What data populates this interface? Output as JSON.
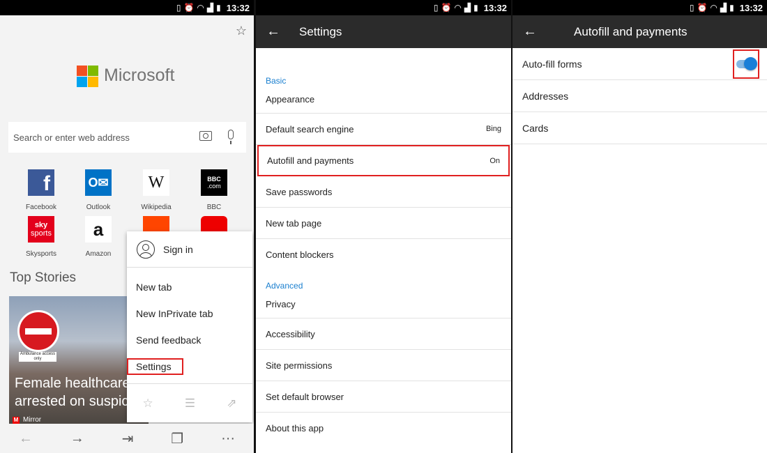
{
  "status": {
    "time": "13:32",
    "icons": [
      "vibrate-icon",
      "alarm-icon",
      "wifi-icon",
      "signal-icon",
      "battery-icon"
    ]
  },
  "home": {
    "brand": "Microsoft",
    "search_placeholder": "Search or enter web address",
    "tiles": [
      {
        "label": "Facebook",
        "glyph": "f",
        "color": "#3b5998"
      },
      {
        "label": "Outlook",
        "glyph": "O",
        "color": "#0072c6"
      },
      {
        "label": "Wikipedia",
        "glyph": "W",
        "color": "#ffffff"
      },
      {
        "label": "BBC",
        "glyph": "BBC",
        "color": "#000000"
      },
      {
        "label": "Skysports",
        "glyph": "sky",
        "color": "#e3001b"
      },
      {
        "label": "Amazon",
        "glyph": "a",
        "color": "#ffffff"
      }
    ],
    "top_stories": "Top Stories",
    "story": {
      "title": "Female healthcare worker arrested on suspicion",
      "source": "Mirror",
      "plate": "Ambulance access only"
    },
    "menu": {
      "sign_in": "Sign in",
      "items": [
        "New tab",
        "New InPrivate tab",
        "Send feedback",
        "Settings"
      ]
    }
  },
  "settings": {
    "title": "Settings",
    "section_basic": "Basic",
    "section_advanced": "Advanced",
    "basic": [
      {
        "label": "Appearance",
        "value": ""
      },
      {
        "label": "Default search engine",
        "value": "Bing"
      },
      {
        "label": "Autofill and payments",
        "value": "On"
      },
      {
        "label": "Save passwords",
        "value": ""
      },
      {
        "label": "New tab page",
        "value": ""
      },
      {
        "label": "Content blockers",
        "value": ""
      }
    ],
    "advanced": [
      {
        "label": "Privacy"
      },
      {
        "label": "Accessibility"
      },
      {
        "label": "Site permissions"
      },
      {
        "label": "Set default browser"
      },
      {
        "label": "About this app"
      }
    ]
  },
  "autofill": {
    "title": "Autofill and payments",
    "autofill_forms": "Auto-fill forms",
    "autofill_enabled": true,
    "addresses": "Addresses",
    "cards": "Cards"
  },
  "colors": {
    "accent": "#1a7fd8",
    "highlight": "#e02020",
    "appbar": "#2b2b2b"
  }
}
